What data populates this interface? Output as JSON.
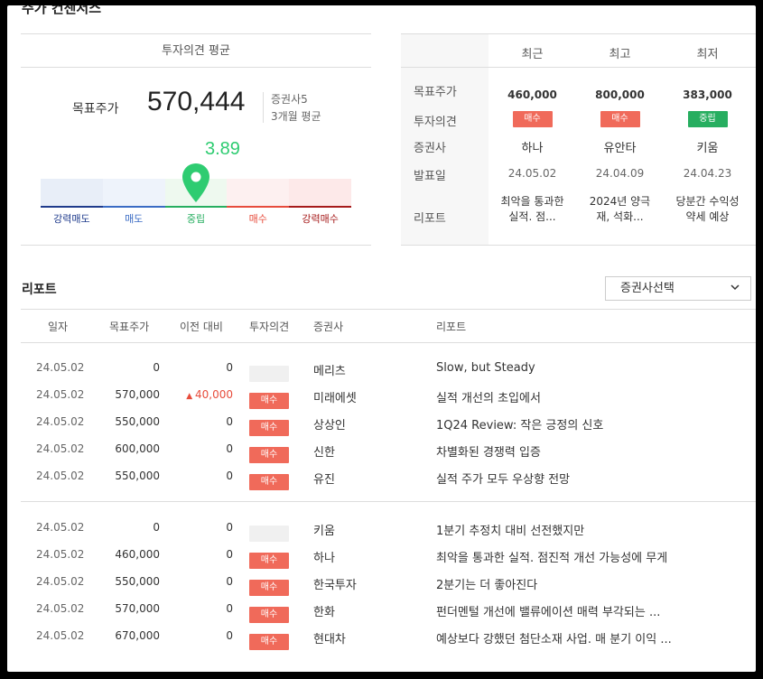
{
  "section": {
    "title": "주가 컨센서스"
  },
  "opinion_avg": {
    "header": "투자의견 평균",
    "target_label": "목표주가",
    "target_value": "570,444",
    "brokers": "증권사5",
    "period": "3개월 평균",
    "score": "3.89",
    "score_fraction": 0.5,
    "scale": [
      {
        "label": "강력매도",
        "bg": "#e8eef8",
        "line": "#1f3b8c",
        "text": "#1f3b8c"
      },
      {
        "label": "매도",
        "bg": "#eef3fb",
        "line": "#3a6bc4",
        "text": "#3a6bc4"
      },
      {
        "label": "중립",
        "bg": "#eef9ef",
        "line": "#27ae60",
        "text": "#27ae60"
      },
      {
        "label": "매수",
        "bg": "#fdf0f0",
        "line": "#e74c3c",
        "text": "#e74c3c"
      },
      {
        "label": "강력매수",
        "bg": "#fde9e9",
        "line": "#a61b1b",
        "text": "#a61b1b"
      }
    ]
  },
  "recent_table": {
    "columns": [
      "최근",
      "최고",
      "최저"
    ],
    "row_labels": [
      "목표주가",
      "투자의견",
      "증권사",
      "발표일",
      "리포트"
    ],
    "prices": [
      "460,000",
      "800,000",
      "383,000"
    ],
    "opinions": [
      {
        "text": "매수",
        "type": "buy"
      },
      {
        "text": "매수",
        "type": "buy"
      },
      {
        "text": "중립",
        "type": "hold"
      }
    ],
    "brokers": [
      "하나",
      "유안타",
      "키움"
    ],
    "dates": [
      "24.05.02",
      "24.04.09",
      "24.04.23"
    ],
    "reports": [
      {
        "l1": "최악을 통과한",
        "l2": "실적. 점..."
      },
      {
        "l1": "2024년 양극",
        "l2": "재, 석화..."
      },
      {
        "l1": "당분간 수익성",
        "l2": "약세 예상"
      }
    ]
  },
  "reports": {
    "title": "리포트",
    "select_label": "증권사선택",
    "headers": [
      "일자",
      "목표주가",
      "이전 대비",
      "투자의견",
      "증권사",
      "리포트"
    ],
    "group1": [
      {
        "date": "24.05.02",
        "price": "0",
        "change": "0",
        "up": false,
        "opinion": "",
        "firm": "메리츠",
        "report": "Slow, but Steady"
      },
      {
        "date": "24.05.02",
        "price": "570,000",
        "change": "40,000",
        "up": true,
        "opinion": "매수",
        "firm": "미래에셋",
        "report": "실적 개선의 초입에서"
      },
      {
        "date": "24.05.02",
        "price": "550,000",
        "change": "0",
        "up": false,
        "opinion": "매수",
        "firm": "상상인",
        "report": "1Q24 Review: 작은 긍정의 신호"
      },
      {
        "date": "24.05.02",
        "price": "600,000",
        "change": "0",
        "up": false,
        "opinion": "매수",
        "firm": "신한",
        "report": "차별화된 경쟁력 입증"
      },
      {
        "date": "24.05.02",
        "price": "550,000",
        "change": "0",
        "up": false,
        "opinion": "매수",
        "firm": "유진",
        "report": "실적 주가 모두 우상향 전망"
      }
    ],
    "group2": [
      {
        "date": "24.05.02",
        "price": "0",
        "change": "0",
        "up": false,
        "opinion": "",
        "firm": "키움",
        "report": "1분기 추정치 대비 선전했지만"
      },
      {
        "date": "24.05.02",
        "price": "460,000",
        "change": "0",
        "up": false,
        "opinion": "매수",
        "firm": "하나",
        "report": "최악을 통과한 실적. 점진적 개선 가능성에 무게"
      },
      {
        "date": "24.05.02",
        "price": "550,000",
        "change": "0",
        "up": false,
        "opinion": "매수",
        "firm": "한국투자",
        "report": "2분기는 더 좋아진다"
      },
      {
        "date": "24.05.02",
        "price": "570,000",
        "change": "0",
        "up": false,
        "opinion": "매수",
        "firm": "한화",
        "report": "펀더멘털 개선에 밸류에이션 매력 부각되는 ..."
      },
      {
        "date": "24.05.02",
        "price": "670,000",
        "change": "0",
        "up": false,
        "opinion": "매수",
        "firm": "현대차",
        "report": "예상보다 강했던 첨단소재 사업. 매 분기 이익 ..."
      }
    ]
  }
}
